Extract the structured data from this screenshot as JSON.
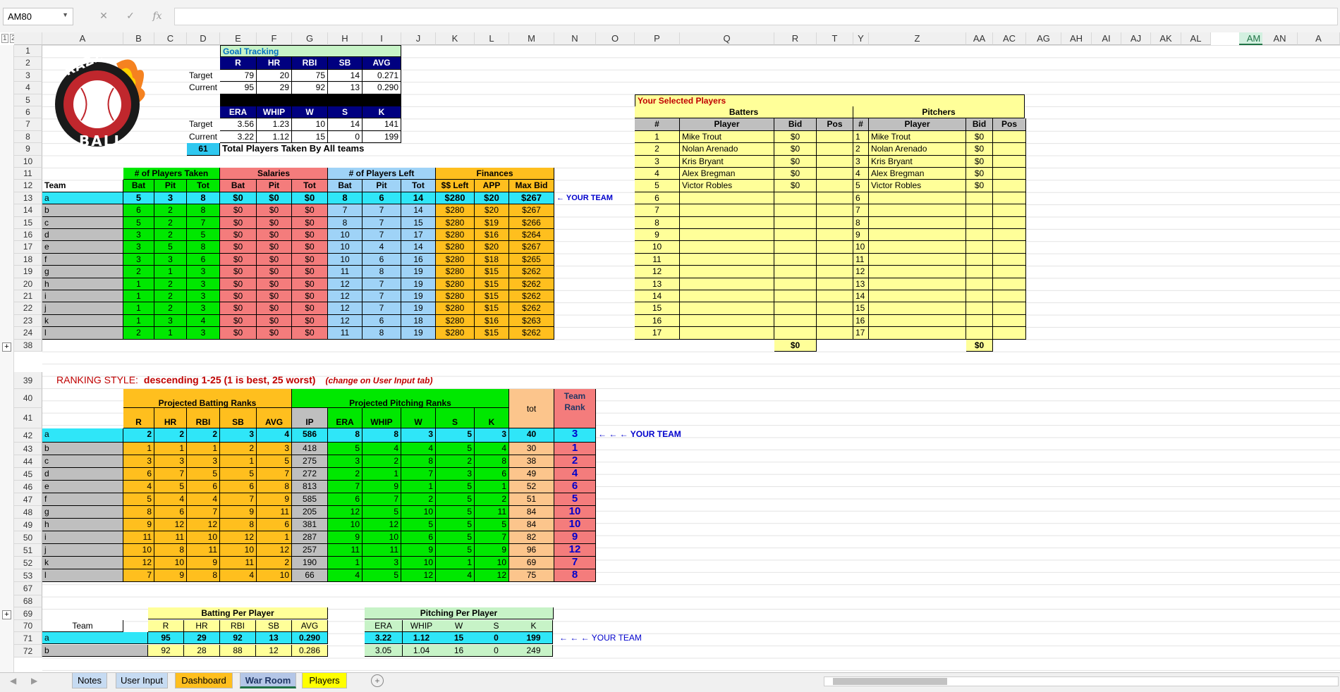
{
  "name_box": "AM80",
  "fx_cancel": "✕",
  "fx_enter": "✓",
  "fx_label": "fx",
  "columns": [
    "A",
    "B",
    "C",
    "D",
    "E",
    "F",
    "G",
    "H",
    "I",
    "J",
    "K",
    "L",
    "M",
    "N",
    "O",
    "P",
    "Q",
    "R",
    "T",
    "Y",
    "Z",
    "AA",
    "AC",
    "AG",
    "AH",
    "AI",
    "AJ",
    "AK",
    "AL",
    "AM",
    "AN",
    "A"
  ],
  "rows_top": [
    "1",
    "2",
    "3",
    "4",
    "5",
    "6",
    "7",
    "8",
    "9",
    "10",
    "11",
    "12",
    "13",
    "14",
    "15",
    "16",
    "17",
    "18",
    "19",
    "20",
    "21",
    "22",
    "23",
    "24",
    "38"
  ],
  "rows_bottom": [
    "39",
    "40",
    "41",
    "42",
    "43",
    "44",
    "45",
    "46",
    "47",
    "48",
    "49",
    "50",
    "51",
    "52",
    "53",
    "67",
    "68",
    "69",
    "70",
    "71",
    "72"
  ],
  "logo": {
    "top": "RAZZ",
    "bottom": "BALL"
  },
  "goal": {
    "title": "Goal Tracking",
    "bat_headers": [
      "R",
      "HR",
      "RBI",
      "SB",
      "AVG"
    ],
    "target_label": "Target",
    "current_label": "Current",
    "bat_target": [
      "79",
      "20",
      "75",
      "14",
      "0.271"
    ],
    "bat_current": [
      "95",
      "29",
      "92",
      "13",
      "0.290"
    ],
    "pit_headers": [
      "ERA",
      "WHIP",
      "W",
      "S",
      "K"
    ],
    "pit_target": [
      "3.56",
      "1.23",
      "10",
      "14",
      "141"
    ],
    "pit_current": [
      "3.22",
      "1.12",
      "15",
      "0",
      "199"
    ],
    "total_taken": "61",
    "total_label": "Total Players Taken By All teams"
  },
  "teams": {
    "group_headers": [
      "# of Players Taken",
      "Salaries",
      "# of Players Left",
      "Finances"
    ],
    "team_label": "Team",
    "sub_headers": [
      "Bat",
      "Pit",
      "Tot",
      "Bat",
      "Pit",
      "Tot",
      "Bat",
      "Pit",
      "Tot",
      "$$ Left",
      "APP",
      "Max Bid"
    ],
    "your_team_note": "← YOUR TEAM",
    "rows": [
      {
        "t": "a",
        "v": [
          "5",
          "3",
          "8",
          "$0",
          "$0",
          "$0",
          "8",
          "6",
          "14",
          "$280",
          "$20",
          "$267"
        ]
      },
      {
        "t": "b",
        "v": [
          "6",
          "2",
          "8",
          "$0",
          "$0",
          "$0",
          "7",
          "7",
          "14",
          "$280",
          "$20",
          "$267"
        ]
      },
      {
        "t": "c",
        "v": [
          "5",
          "2",
          "7",
          "$0",
          "$0",
          "$0",
          "8",
          "7",
          "15",
          "$280",
          "$19",
          "$266"
        ]
      },
      {
        "t": "d",
        "v": [
          "3",
          "2",
          "5",
          "$0",
          "$0",
          "$0",
          "10",
          "7",
          "17",
          "$280",
          "$16",
          "$264"
        ]
      },
      {
        "t": "e",
        "v": [
          "3",
          "5",
          "8",
          "$0",
          "$0",
          "$0",
          "10",
          "4",
          "14",
          "$280",
          "$20",
          "$267"
        ]
      },
      {
        "t": "f",
        "v": [
          "3",
          "3",
          "6",
          "$0",
          "$0",
          "$0",
          "10",
          "6",
          "16",
          "$280",
          "$18",
          "$265"
        ]
      },
      {
        "t": "g",
        "v": [
          "2",
          "1",
          "3",
          "$0",
          "$0",
          "$0",
          "11",
          "8",
          "19",
          "$280",
          "$15",
          "$262"
        ]
      },
      {
        "t": "h",
        "v": [
          "1",
          "2",
          "3",
          "$0",
          "$0",
          "$0",
          "12",
          "7",
          "19",
          "$280",
          "$15",
          "$262"
        ]
      },
      {
        "t": "i",
        "v": [
          "1",
          "2",
          "3",
          "$0",
          "$0",
          "$0",
          "12",
          "7",
          "19",
          "$280",
          "$15",
          "$262"
        ]
      },
      {
        "t": "j",
        "v": [
          "1",
          "2",
          "3",
          "$0",
          "$0",
          "$0",
          "12",
          "7",
          "19",
          "$280",
          "$15",
          "$262"
        ]
      },
      {
        "t": "k",
        "v": [
          "1",
          "3",
          "4",
          "$0",
          "$0",
          "$0",
          "12",
          "6",
          "18",
          "$280",
          "$16",
          "$263"
        ]
      },
      {
        "t": "l",
        "v": [
          "2",
          "1",
          "3",
          "$0",
          "$0",
          "$0",
          "11",
          "8",
          "19",
          "$280",
          "$15",
          "$262"
        ]
      }
    ]
  },
  "selected": {
    "title": "Your Selected Players",
    "batters_label": "Batters",
    "pitchers_label": "Pitchers",
    "headers": [
      "#",
      "Player",
      "Bid",
      "Pos"
    ],
    "batters": [
      "Mike Trout",
      "Nolan Arenado",
      "Kris Bryant",
      "Alex Bregman",
      "Victor Robles"
    ],
    "pitchers": [
      "Mike Trout",
      "Nolan Arenado",
      "Kris Bryant",
      "Alex Bregman",
      "Victor Robles"
    ],
    "bid": "$0",
    "numbers": [
      "1",
      "2",
      "3",
      "4",
      "5",
      "6",
      "7",
      "8",
      "9",
      "10",
      "11",
      "12",
      "13",
      "14",
      "15",
      "16",
      "17"
    ],
    "total_bat": "$0",
    "total_pit": "$0"
  },
  "ranking": {
    "label": "RANKING STYLE:",
    "style": "descending 1-25   (1 is best, 25 worst)",
    "hint": "(change on User Input tab)",
    "bat_group": "Projected Batting Ranks",
    "pit_group": "Projected Pitching Ranks",
    "tot_label": "tot",
    "rank_label": "Team Rank",
    "headers": [
      "R",
      "HR",
      "RBI",
      "SB",
      "AVG",
      "IP",
      "ERA",
      "WHIP",
      "W",
      "S",
      "K"
    ],
    "your_team_note": "← ← ←  YOUR TEAM",
    "rows": [
      {
        "t": "a",
        "v": [
          "2",
          "2",
          "2",
          "3",
          "4",
          "586",
          "8",
          "8",
          "3",
          "5",
          "3"
        ],
        "tot": "40",
        "rank": "3"
      },
      {
        "t": "b",
        "v": [
          "1",
          "1",
          "1",
          "2",
          "3",
          "418",
          "5",
          "4",
          "4",
          "5",
          "4"
        ],
        "tot": "30",
        "rank": "1"
      },
      {
        "t": "c",
        "v": [
          "3",
          "3",
          "3",
          "1",
          "5",
          "275",
          "3",
          "2",
          "8",
          "2",
          "8"
        ],
        "tot": "38",
        "rank": "2"
      },
      {
        "t": "d",
        "v": [
          "6",
          "7",
          "5",
          "5",
          "7",
          "272",
          "2",
          "1",
          "7",
          "3",
          "6"
        ],
        "tot": "49",
        "rank": "4"
      },
      {
        "t": "e",
        "v": [
          "4",
          "5",
          "6",
          "6",
          "8",
          "813",
          "7",
          "9",
          "1",
          "5",
          "1"
        ],
        "tot": "52",
        "rank": "6"
      },
      {
        "t": "f",
        "v": [
          "5",
          "4",
          "4",
          "7",
          "9",
          "585",
          "6",
          "7",
          "2",
          "5",
          "2"
        ],
        "tot": "51",
        "rank": "5"
      },
      {
        "t": "g",
        "v": [
          "8",
          "6",
          "7",
          "9",
          "11",
          "205",
          "12",
          "5",
          "10",
          "5",
          "11"
        ],
        "tot": "84",
        "rank": "10"
      },
      {
        "t": "h",
        "v": [
          "9",
          "12",
          "12",
          "8",
          "6",
          "381",
          "10",
          "12",
          "5",
          "5",
          "5"
        ],
        "tot": "84",
        "rank": "10"
      },
      {
        "t": "i",
        "v": [
          "11",
          "11",
          "10",
          "12",
          "1",
          "287",
          "9",
          "10",
          "6",
          "5",
          "7"
        ],
        "tot": "82",
        "rank": "9"
      },
      {
        "t": "j",
        "v": [
          "10",
          "8",
          "11",
          "10",
          "12",
          "257",
          "11",
          "11",
          "9",
          "5",
          "9"
        ],
        "tot": "96",
        "rank": "12"
      },
      {
        "t": "k",
        "v": [
          "12",
          "10",
          "9",
          "11",
          "2",
          "190",
          "1",
          "3",
          "10",
          "1",
          "10"
        ],
        "tot": "69",
        "rank": "7"
      },
      {
        "t": "l",
        "v": [
          "7",
          "9",
          "8",
          "4",
          "10",
          "66",
          "4",
          "5",
          "12",
          "4",
          "12"
        ],
        "tot": "75",
        "rank": "8"
      }
    ]
  },
  "perplayer": {
    "team_label": "Team",
    "bat_group": "Batting Per Player",
    "pit_group": "Pitching Per Player",
    "bat_headers": [
      "R",
      "HR",
      "RBI",
      "SB",
      "AVG"
    ],
    "pit_headers": [
      "ERA",
      "WHIP",
      "W",
      "S",
      "K"
    ],
    "row_team": "a",
    "bat_values": [
      "95",
      "29",
      "92",
      "13",
      "0.290"
    ],
    "pit_values": [
      "3.22",
      "1.12",
      "15",
      "0",
      "199"
    ],
    "row_team2": "b",
    "bat_values2": [
      "92",
      "28",
      "88",
      "12",
      "0.286"
    ],
    "pit_values2": [
      "3.05",
      "1.04",
      "16",
      "0",
      "249"
    ],
    "your_team_note": "← ← ←  YOUR TEAM"
  },
  "tabs": [
    "Notes",
    "User Input",
    "Dashboard",
    "War Room",
    "Players"
  ],
  "colors": {
    "accent": "#217346",
    "navy": "#000080"
  }
}
